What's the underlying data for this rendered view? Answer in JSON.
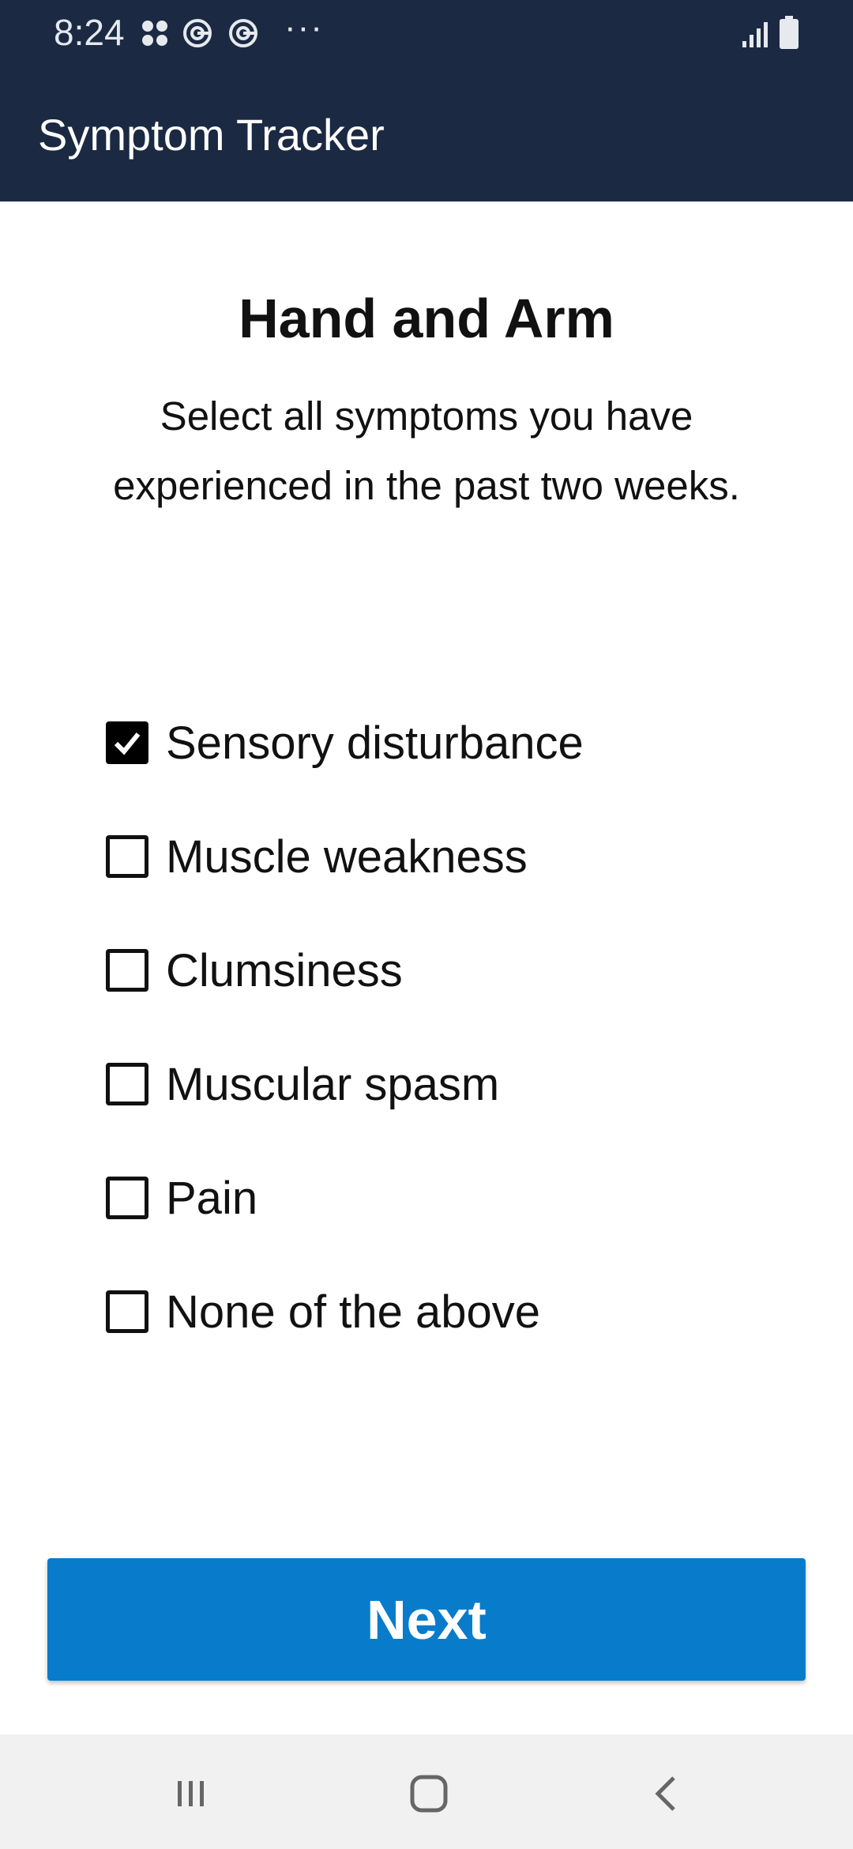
{
  "status_bar": {
    "time": "8:24",
    "overflow_dots": "···",
    "icons": [
      "apps-grid-icon",
      "sync-icon",
      "sync-icon",
      "signal-icon",
      "battery-icon"
    ]
  },
  "app": {
    "title": "Symptom Tracker",
    "header_color": "#1b2a42"
  },
  "page": {
    "title": "Hand and Arm",
    "instructions": "Select all symptoms you have experienced in the past two weeks."
  },
  "options": [
    {
      "label": "Sensory disturbance",
      "checked": true
    },
    {
      "label": "Muscle weakness",
      "checked": false
    },
    {
      "label": "Clumsiness",
      "checked": false
    },
    {
      "label": "Muscular spasm",
      "checked": false
    },
    {
      "label": "Pain",
      "checked": false
    },
    {
      "label": "None of the above",
      "checked": false
    }
  ],
  "footer": {
    "next_label": "Next",
    "accent_color": "#087ccb"
  },
  "navbar": {
    "icons": [
      "recent-apps-icon",
      "home-icon",
      "back-icon"
    ]
  }
}
